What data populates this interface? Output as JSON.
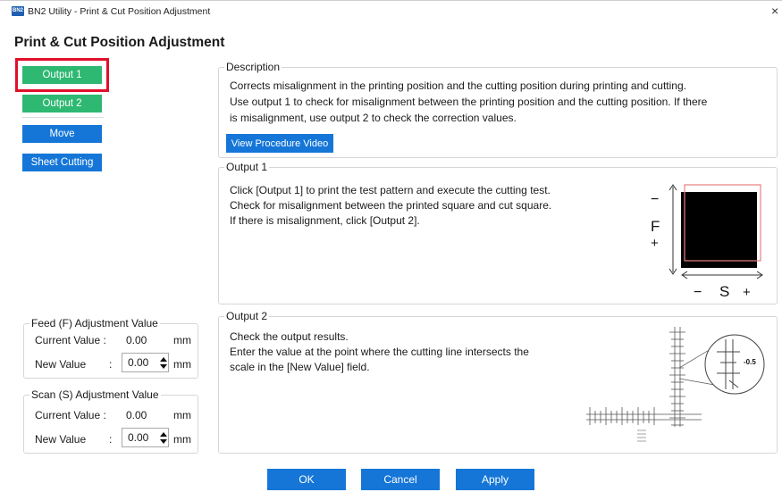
{
  "window": {
    "app_icon_text": "BN2",
    "title": "BN2 Utility - Print & Cut Position Adjustment",
    "close_glyph": "×"
  },
  "page_title": "Print & Cut Position Adjustment",
  "sidebar": {
    "output1_label": "Output 1",
    "output2_label": "Output 2",
    "move_label": "Move",
    "sheet_cutting_label": "Sheet Cutting"
  },
  "feed": {
    "legend": "Feed (F) Adjustment Value",
    "current_label": "Current Value :",
    "current_value": "0.00",
    "current_unit": "mm",
    "new_label": "New Value",
    "new_colon": ":",
    "new_value": "0.00",
    "new_unit": "mm"
  },
  "scan": {
    "legend": "Scan (S) Adjustment Value",
    "current_label": "Current Value :",
    "current_value": "0.00",
    "current_unit": "mm",
    "new_label": "New Value",
    "new_colon": ":",
    "new_value": "0.00",
    "new_unit": "mm"
  },
  "description": {
    "legend": "Description",
    "line1": "Corrects misalignment in the printing position and the cutting position during printing and cutting.",
    "line2": "Use output 1 to check for misalignment between the printing position and the cutting position. If there",
    "line3": "is misalignment, use output 2 to check the correction values.",
    "video_button": "View Procedure Video"
  },
  "output1": {
    "legend": "Output 1",
    "line1": "Click [Output 1] to print the test pattern and execute the cutting test.",
    "line2": "Check for misalignment between the printed square and cut square.",
    "line3": "If there is misalignment, click [Output 2].",
    "diagram": {
      "minus_top": "−",
      "f_label": "F",
      "plus_bottom": "+",
      "minus_left": "−",
      "s_label": "S",
      "plus_right": "+"
    }
  },
  "output2": {
    "legend": "Output 2",
    "line1": "Check the output results.",
    "line2": "Enter the value at the point where the cutting line intersects the",
    "line3": "scale in the [New Value] field.",
    "diagram": {
      "zoom_value": "-0.5"
    }
  },
  "footer": {
    "ok_label": "OK",
    "cancel_label": "Cancel",
    "apply_label": "Apply"
  },
  "colors": {
    "green": "#2eb872",
    "blue": "#1576d8",
    "highlight": "#e0102a"
  }
}
